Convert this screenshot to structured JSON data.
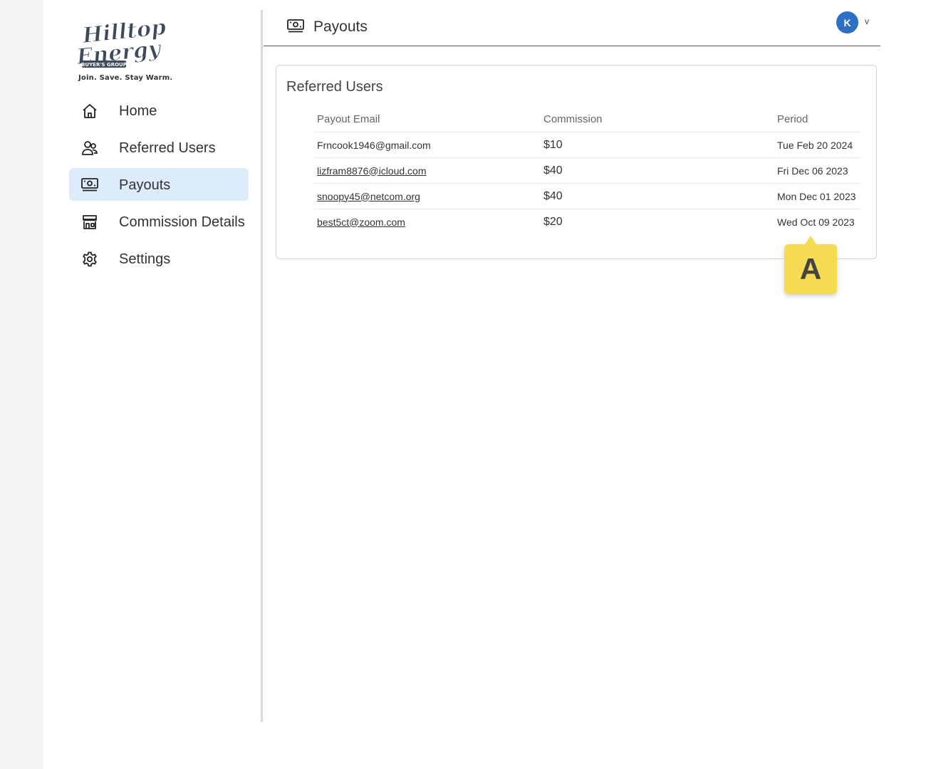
{
  "brand": {
    "logo_line1": "Hilltop",
    "logo_line2": "Energy",
    "logo_sub": "BUYER'S GROUP",
    "tagline": "Join. Save. Stay Warm."
  },
  "sidebar": {
    "items": [
      {
        "label": "Home",
        "icon": "home-icon",
        "active": false
      },
      {
        "label": "Referred Users",
        "icon": "users-icon",
        "active": false
      },
      {
        "label": "Payouts",
        "icon": "money-icon",
        "active": true
      },
      {
        "label": "Commission Details",
        "icon": "store-icon",
        "active": false
      },
      {
        "label": "Settings",
        "icon": "gear-icon",
        "active": false
      }
    ],
    "active_color": "#dcecfb"
  },
  "header": {
    "title": "Payouts",
    "icon": "money-icon",
    "avatar_initial": "K",
    "avatar_color": "#2d6fc2",
    "caret": "v"
  },
  "card": {
    "title": "Referred Users",
    "columns": [
      "Payout Email",
      "Commission",
      "Period"
    ],
    "rows": [
      {
        "email": "Frncook1946@gmail.com",
        "commission": "$10",
        "period": "Tue Feb 20 2024",
        "link": false
      },
      {
        "email": "lizfram8876@icloud.com",
        "commission": "$40",
        "period": "Fri Dec 06 2023",
        "link": true
      },
      {
        "email": "snoopy45@netcom.org",
        "commission": "$40",
        "period": "Mon Dec 01 2023",
        "link": true
      },
      {
        "email": "best5ct@zoom.com",
        "commission": "$20",
        "period": "Wed Oct 09 2023",
        "link": true
      }
    ]
  },
  "marker": {
    "label": "A",
    "color": "#f6dc52"
  }
}
